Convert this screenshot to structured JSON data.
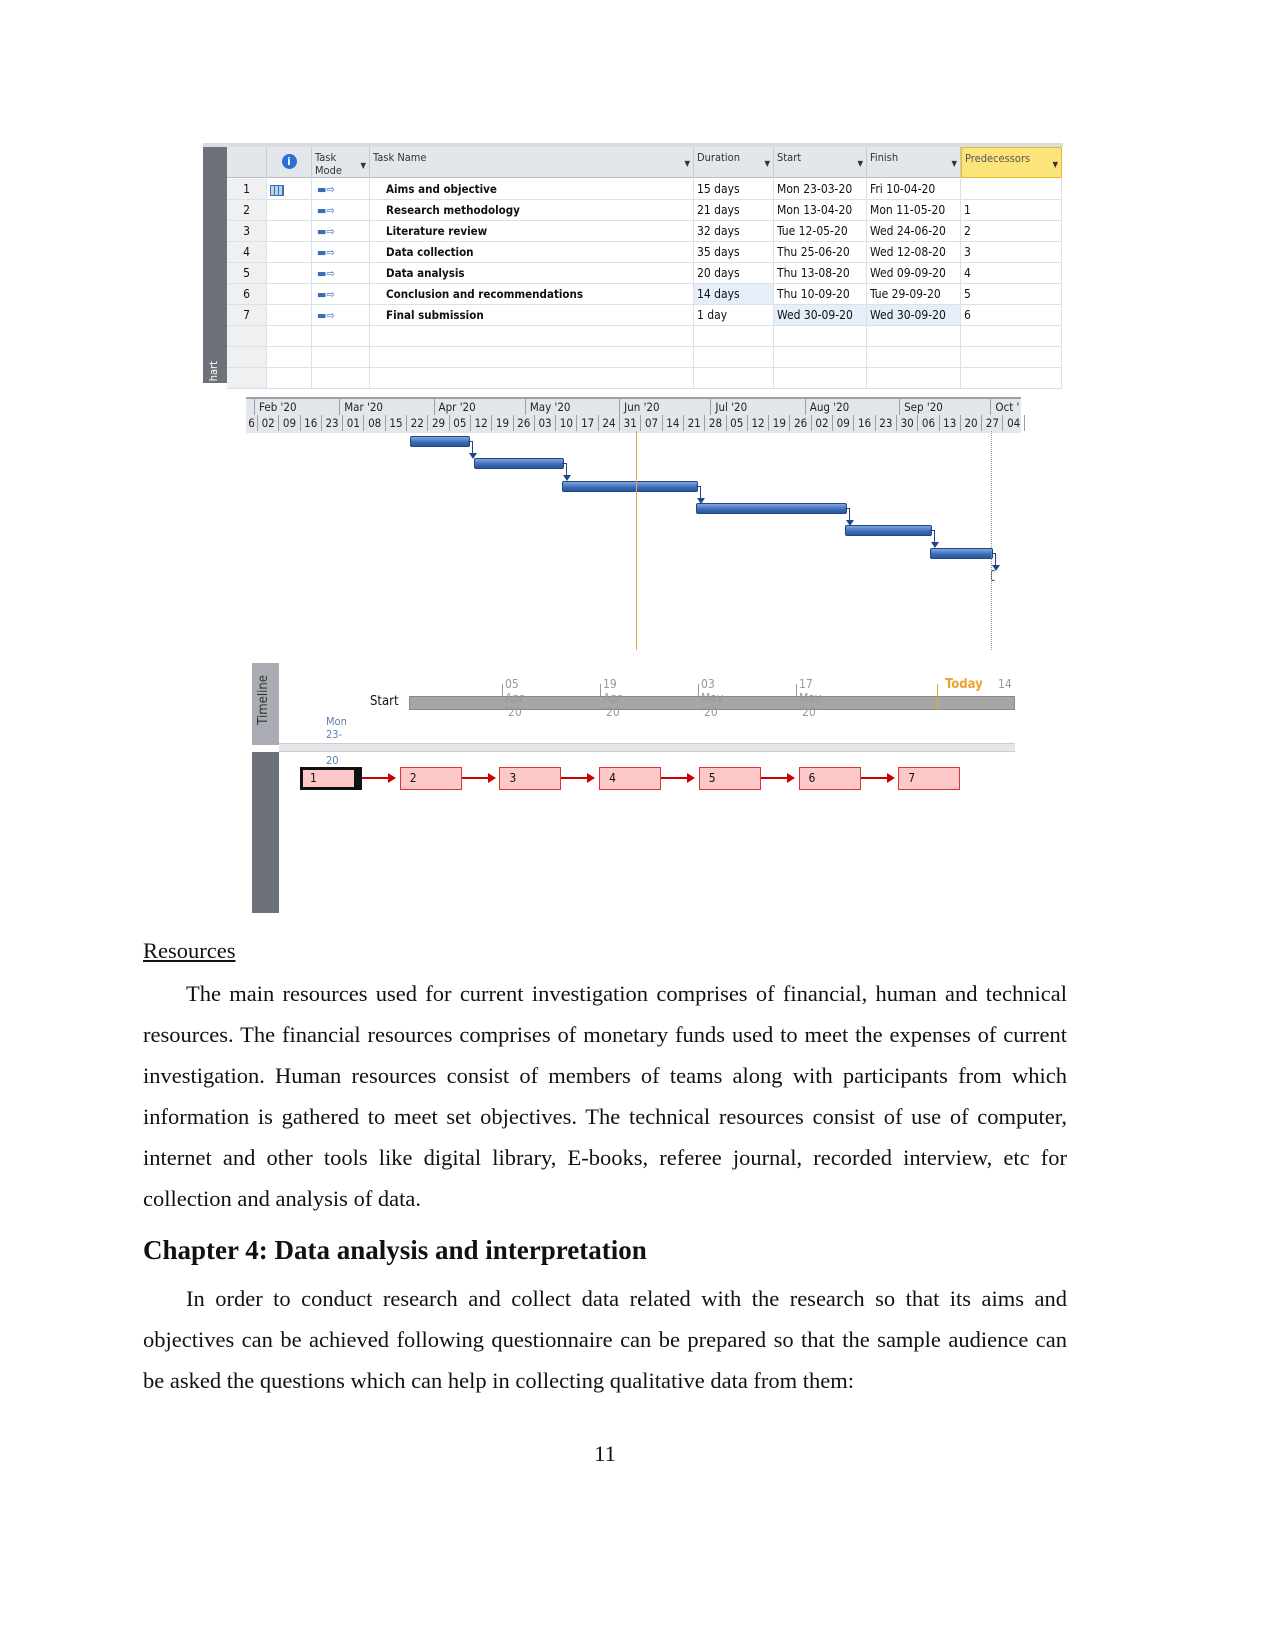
{
  "project": {
    "side_label": "hart",
    "columns": {
      "task_mode": "Task Mode",
      "task_name": "Task Name",
      "duration": "Duration",
      "start": "Start",
      "finish": "Finish",
      "predecessors": "Predecessors"
    },
    "tasks": [
      {
        "id": "1",
        "name": "Aims and objective",
        "duration": "15 days",
        "start": "Mon 23-03-20",
        "finish": "Fri 10-04-20",
        "pred": "",
        "s": "2020-03-23",
        "f": "2020-04-10"
      },
      {
        "id": "2",
        "name": "Research methodology",
        "duration": "21 days",
        "start": "Mon 13-04-20",
        "finish": "Mon 11-05-20",
        "pred": "1",
        "s": "2020-04-13",
        "f": "2020-05-11"
      },
      {
        "id": "3",
        "name": "Literature review",
        "duration": "32 days",
        "start": "Tue 12-05-20",
        "finish": "Wed 24-06-20",
        "pred": "2",
        "s": "2020-05-12",
        "f": "2020-06-24"
      },
      {
        "id": "4",
        "name": "Data collection",
        "duration": "35 days",
        "start": "Thu 25-06-20",
        "finish": "Wed 12-08-20",
        "pred": "3",
        "s": "2020-06-25",
        "f": "2020-08-12"
      },
      {
        "id": "5",
        "name": "Data analysis",
        "duration": "20 days",
        "start": "Thu 13-08-20",
        "finish": "Wed 09-09-20",
        "pred": "4",
        "s": "2020-08-13",
        "f": "2020-09-09"
      },
      {
        "id": "6",
        "name": "Conclusion and recommendations",
        "duration": "14 days",
        "start": "Thu 10-09-20",
        "finish": "Tue 29-09-20",
        "pred": "5",
        "s": "2020-09-10",
        "f": "2020-09-29"
      },
      {
        "id": "7",
        "name": "Final submission",
        "duration": "1 day",
        "start": "Wed 30-09-20",
        "finish": "Wed 30-09-20",
        "pred": "6",
        "s": "2020-09-30",
        "f": "2020-09-30"
      }
    ],
    "months": [
      "Feb '20",
      "Mar '20",
      "Apr '20",
      "May '20",
      "Jun '20",
      "Jul '20",
      "Aug '20",
      "Sep '20",
      "Oct '"
    ],
    "weeks": [
      "6",
      "02",
      "09",
      "16",
      "23",
      "01",
      "08",
      "15",
      "22",
      "29",
      "05",
      "12",
      "19",
      "26",
      "03",
      "10",
      "17",
      "24",
      "31",
      "07",
      "14",
      "21",
      "28",
      "05",
      "12",
      "19",
      "26",
      "02",
      "09",
      "16",
      "23",
      "30",
      "06",
      "13",
      "20",
      "27",
      "04"
    ],
    "bar_color": "#3c6bb6",
    "today_color": "#f0a050"
  },
  "timeline": {
    "label": "Timeline",
    "start_label": "Start",
    "start_date": "Mon 23-03-20",
    "ticks": [
      "05 Apr '20",
      "19 Apr '20",
      "03 May '20",
      "17 May '20"
    ],
    "today": "Today",
    "end_tick": "14"
  },
  "network": {
    "nodes": [
      "1",
      "2",
      "3",
      "4",
      "5",
      "6",
      "7"
    ]
  },
  "document": {
    "resources_heading": "Resources",
    "resources_text": "The main resources used for current investigation comprises of financial, human and technical resources. The financial resources comprises of monetary funds used to meet the expenses of current investigation. Human resources consist of members of teams along with participants from which information is gathered to meet set objectives. The technical resources consist of use of computer, internet and other tools like digital library, E-books, referee journal, recorded interview, etc for collection and analysis of data.",
    "chapter_heading": "Chapter 4: Data analysis and interpretation",
    "chapter_text": "In order to conduct research and collect data related with the research so that its aims and objectives can be achieved following questionnaire can be prepared so that the sample audience can be asked the questions which can help in collecting qualitative data from them:",
    "page_number": "11"
  }
}
